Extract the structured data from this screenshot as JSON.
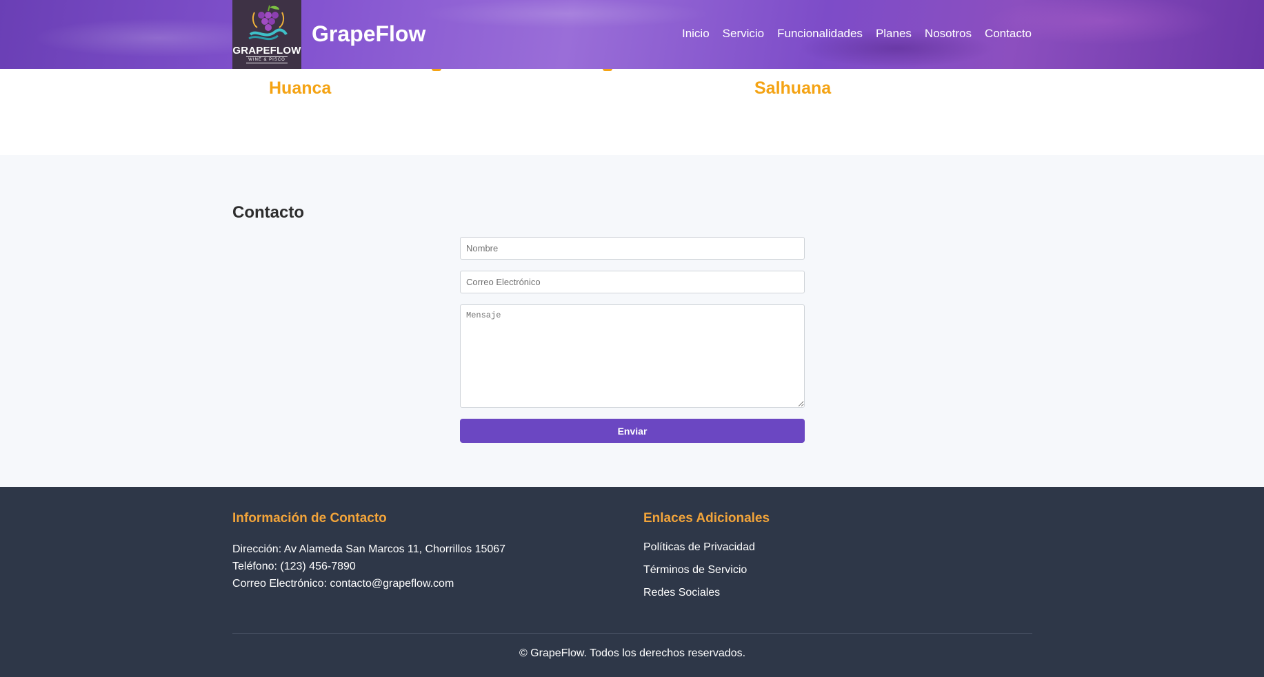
{
  "header": {
    "logo": {
      "text": "GRAPEFLOW",
      "subtext": "WINE & PISCO"
    },
    "brand": "GrapeFlow",
    "nav": [
      {
        "label": "Inicio"
      },
      {
        "label": "Servicio"
      },
      {
        "label": "Funcionalidades"
      },
      {
        "label": "Planes"
      },
      {
        "label": "Nosotros"
      },
      {
        "label": "Contacto"
      }
    ]
  },
  "varieties": [
    "Huanca",
    "Salhuana"
  ],
  "contact": {
    "title": "Contacto",
    "name_placeholder": "Nombre",
    "email_placeholder": "Correo Electrónico",
    "message_placeholder": "Mensaje",
    "submit_label": "Enviar",
    "button_color": "#6b47c2"
  },
  "footer": {
    "info_heading": "Información de Contacto",
    "address": "Dirección: Av Alameda San Marcos 11, Chorrillos 15067",
    "phone": "Teléfono: (123) 456-7890",
    "email": "Correo Electrónico: contacto@grapeflow.com",
    "links_heading": "Enlaces Adicionales",
    "links": [
      {
        "label": "Políticas de Privacidad"
      },
      {
        "label": "Términos de Servicio"
      },
      {
        "label": "Redes Sociales"
      }
    ],
    "copyright": "© GrapeFlow. Todos los derechos reservados.",
    "heading_color": "#f2a43a",
    "background_color": "#2e3748"
  },
  "accent_color": "#f4a314"
}
